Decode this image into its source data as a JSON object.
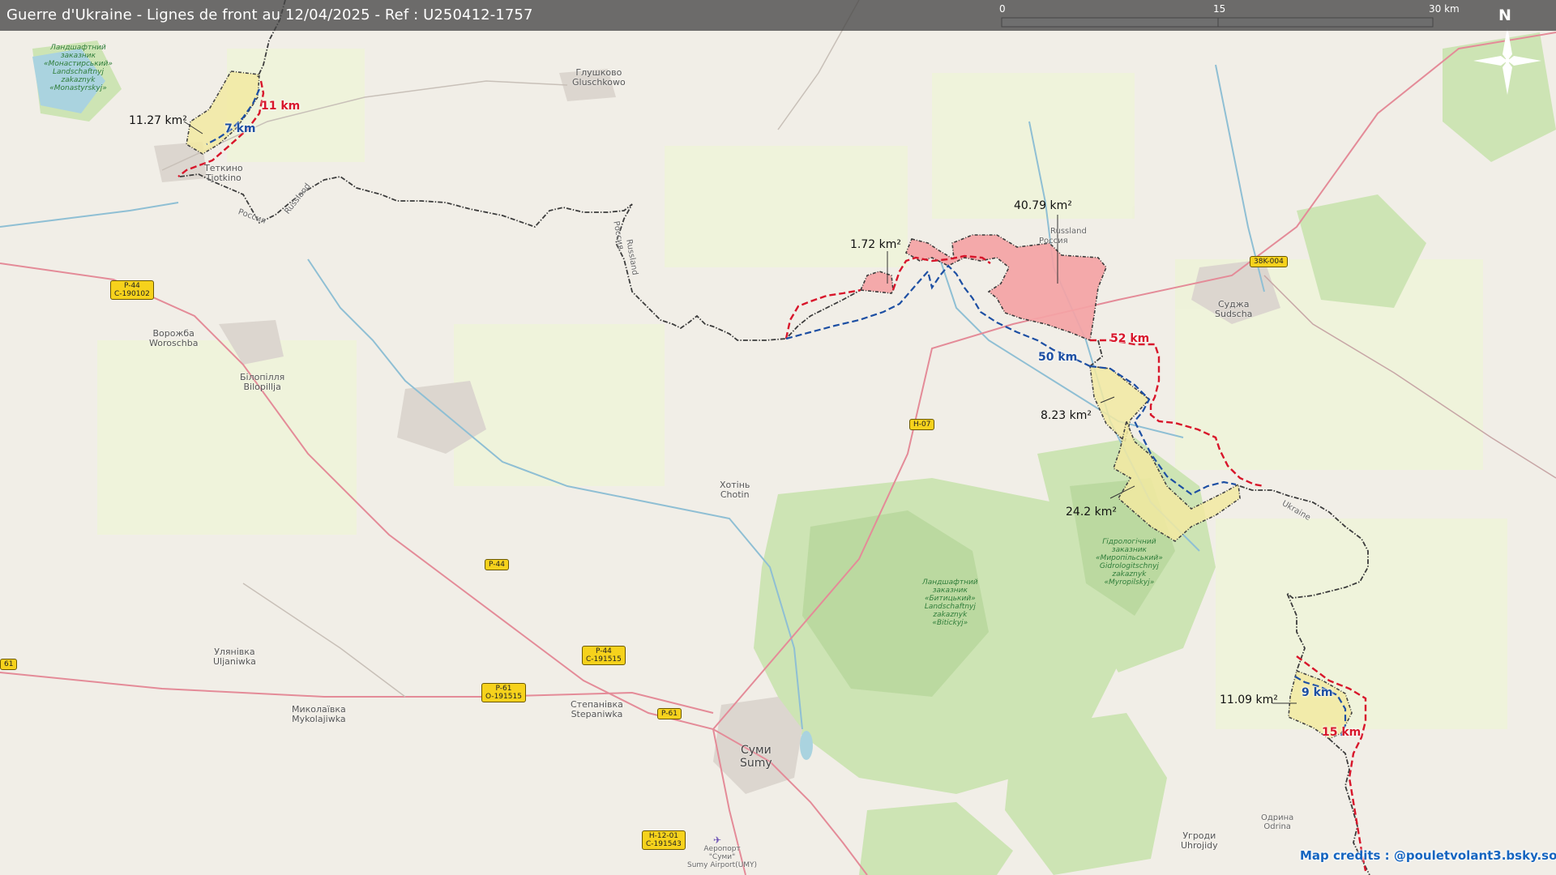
{
  "title": "Guerre d'Ukraine - Lignes de front au 12/04/2025 - Ref : U250412-1757",
  "scale_bar": {
    "ticks": [
      "0",
      "15",
      "30 km"
    ]
  },
  "north_label": "N",
  "credits": "Map credits : @pouletvolant3.bsky.social",
  "colors": {
    "occupied_fill": "#f2e9a1",
    "liberated_fill": "#f4a3a5",
    "line_red": "#d8162b",
    "line_blue": "#1d4fa3",
    "border_line": "#3c3c3c"
  },
  "areas": [
    "11.27 km²",
    "1.72 km²",
    "40.79 km²",
    "8.23 km²",
    "24.2 km²",
    "11.09 km²"
  ],
  "distances": {
    "red": [
      "11 km",
      "52 km",
      "15 km"
    ],
    "blue": [
      "7 km",
      "50 km",
      "9 km"
    ]
  },
  "places": {
    "hlushkovo": "Глушково\nGluschkowo",
    "tetkino": "Теткино\nTjotkino",
    "vorozhba": "Ворожба\nWoroschba",
    "bilopillia": "Білопілля\nBilopillja",
    "khotin": "Хотінь\nChotin",
    "sudzha": "Суджа\nSudscha",
    "ulianivka": "Улянівка\nUljaniwka",
    "mykolaivka": "Миколаївка\nMykolajiwka",
    "stepanivka": "Степанівка\nStepaniwka",
    "sumy": "Суми\nSumy",
    "uhroidy": "Угроди\nUhrojidy",
    "airport": "Аеропорт\n\"Суми\"\nSumy Airport(UMY)",
    "odryna": "Одрина\nOdrina"
  },
  "border_labels": [
    "Russland",
    "Россия",
    "Russland",
    "Россия",
    "Russland",
    "Россия",
    "Ukraine"
  ],
  "nature_labels": [
    "Ландшафтний\nзаказник\n«Монастирський»\nLandschaftnyj\nzakaznyk\n«Monastyrskyj»",
    "Гідрологічний\nзаказник\n«Миропільський»\nGidrologitschnyj\nzakaznyk\n«Myropilskyj»",
    "Ландшафтний\nзаказник\n«Битицький»\nLandschaftnyj\nzakaznyk\n«Bitickyj»"
  ],
  "road_shields": [
    "P-44\nC-190102",
    "38K-004",
    "H-07",
    "P-44",
    "P-44\nC-191515",
    "P-61\nO-191515",
    "P-61",
    "H-12-01\nC-191543",
    "61"
  ]
}
